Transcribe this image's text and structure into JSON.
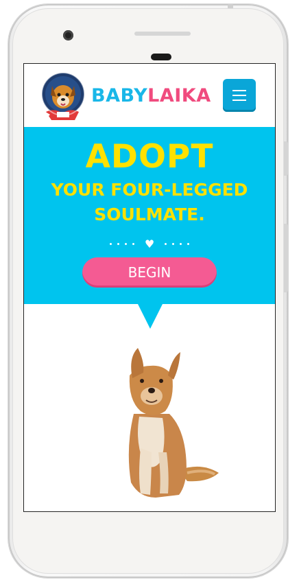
{
  "header": {
    "brand_part1": "BABY",
    "brand_part2": "LAIKA",
    "logo_icon": "astronaut-dog-logo",
    "menu_icon": "hamburger-menu-icon"
  },
  "hero": {
    "title": "ADOPT",
    "subtitle_line1": "YOUR FOUR-LEGGED",
    "subtitle_line2": "SOULMATE.",
    "divider_icon": "heart-icon",
    "begin_label": "BEGIN"
  },
  "image": {
    "subject": "dog-photo"
  },
  "colors": {
    "hero_bg": "#00c4ee",
    "title_yellow": "#ffe100",
    "button_pink": "#f45b93",
    "brand_blue": "#19b7e8",
    "brand_pink": "#f04b7e",
    "menu_blue": "#0aa6d8"
  }
}
